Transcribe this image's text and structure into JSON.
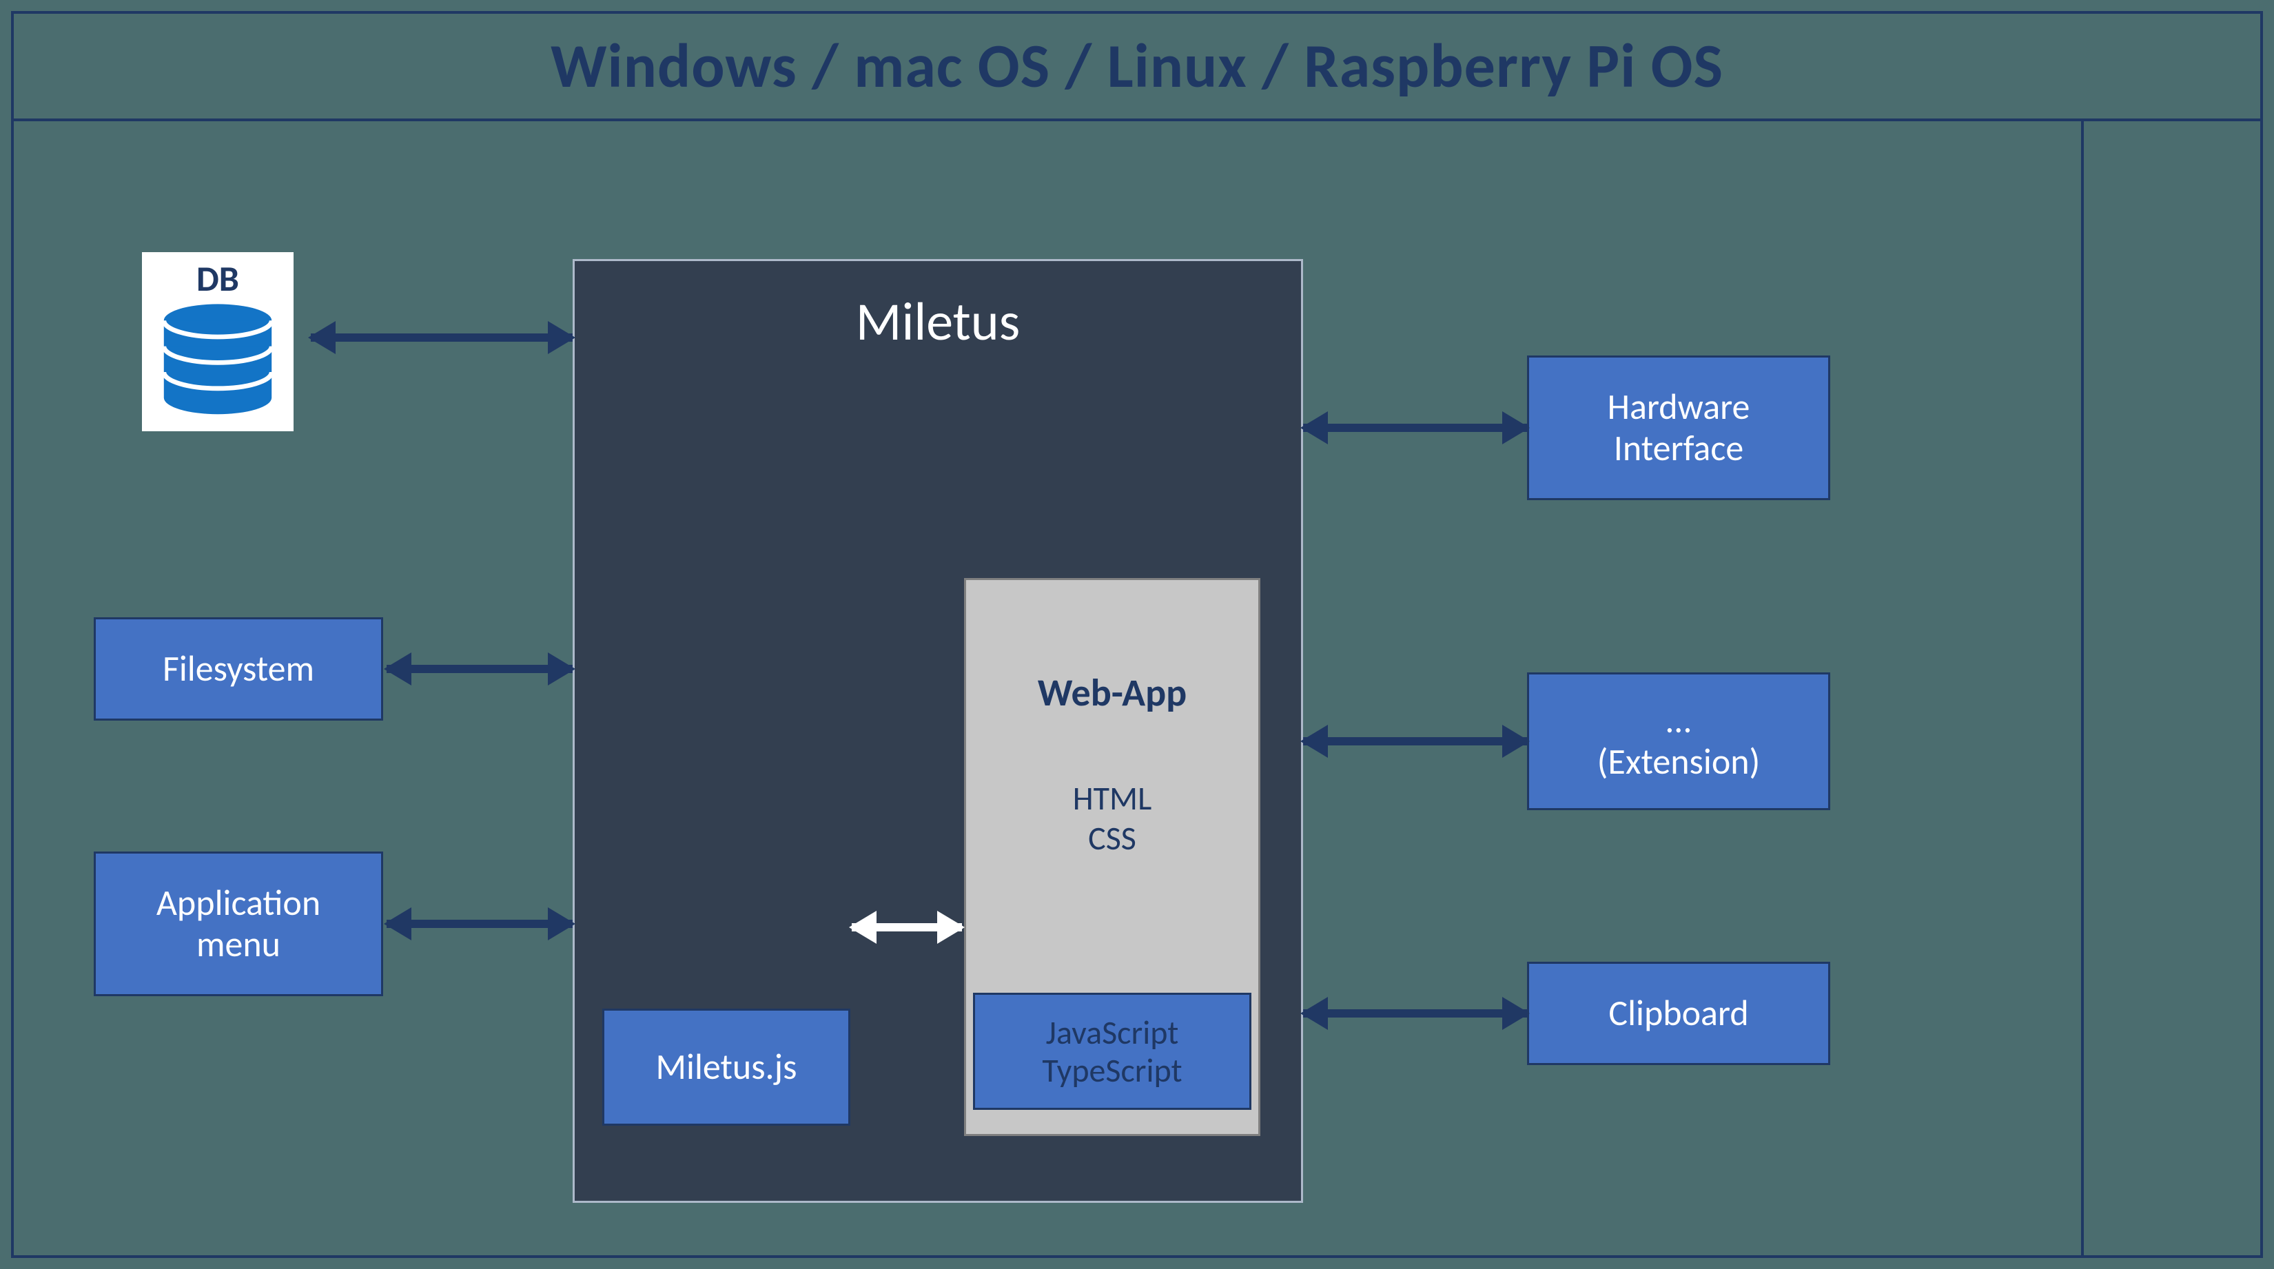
{
  "title": "Windows / mac OS / Linux / Raspberry Pi OS",
  "db": {
    "label": "DB"
  },
  "left_boxes": {
    "filesystem": "Filesystem",
    "app_menu": "Application\nmenu"
  },
  "right_boxes": {
    "hardware": "Hardware\nInterface",
    "extension": "…\n(Extension)",
    "clipboard": "Clipboard"
  },
  "miletus": {
    "title": "Miletus",
    "js_box": "Miletus.js",
    "webapp": {
      "title": "Web-App",
      "sub": "HTML\nCSS",
      "script": "JavaScript\nTypeScript"
    }
  }
}
